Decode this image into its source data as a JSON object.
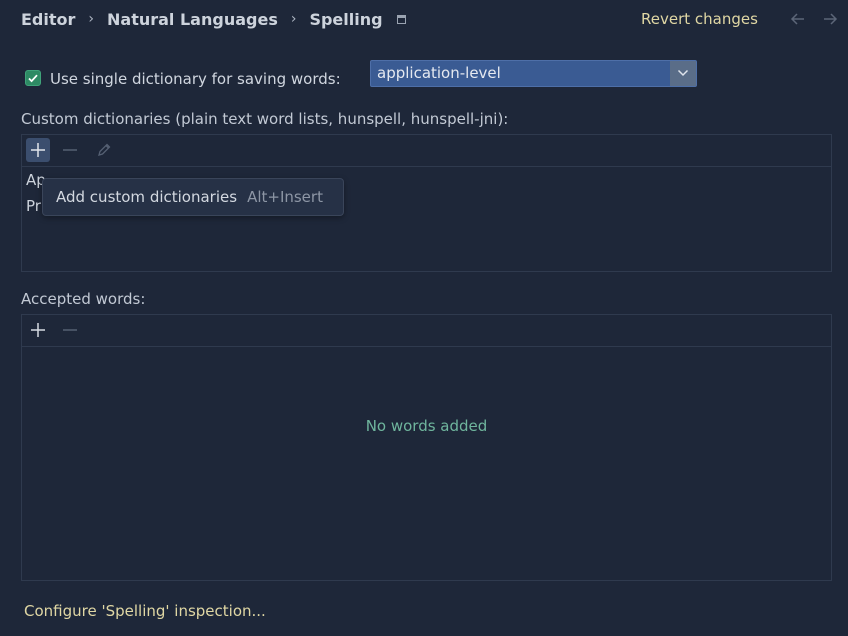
{
  "breadcrumb": {
    "items": [
      "Editor",
      "Natural Languages",
      "Spelling"
    ],
    "separator": "›"
  },
  "header": {
    "revert_label": "Revert changes",
    "back_icon": "arrow-left-icon",
    "forward_icon": "arrow-right-icon"
  },
  "single_dictionary": {
    "checked": true,
    "label": "Use single dictionary for saving words:",
    "selected_value": "application-level"
  },
  "custom_dictionaries": {
    "label": "Custom dictionaries (plain text word lists, hunspell, hunspell-jni):",
    "items": [
      "Ap",
      "Pr"
    ]
  },
  "tooltip": {
    "text": "Add custom dictionaries",
    "shortcut": "Alt+Insert"
  },
  "accepted_words": {
    "label": "Accepted words:",
    "empty_text": "No words added"
  },
  "footer": {
    "configure_link": "Configure 'Spelling' inspection..."
  },
  "colors": {
    "background": "#1e2739",
    "accent_link": "#e0d7a4",
    "checkbox": "#2e8a64",
    "combo": "#3a5b93",
    "empty_text": "#6fb59d"
  }
}
